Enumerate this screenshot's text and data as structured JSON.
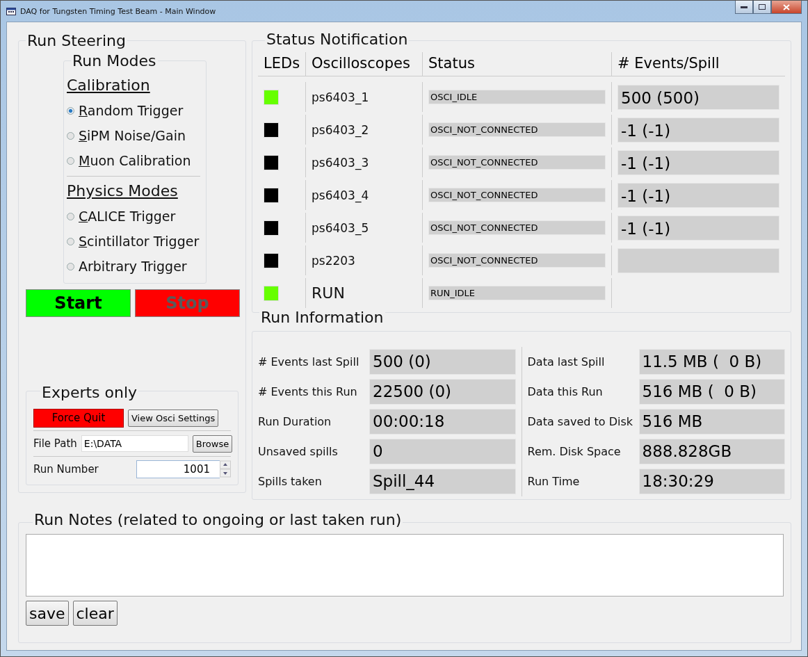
{
  "window": {
    "title": "DAQ for Tungsten Timing Test Beam - Main Window"
  },
  "run_steering": {
    "title": "Run Steering",
    "run_modes": {
      "title": "Run Modes",
      "groups": [
        {
          "heading": "Calibration",
          "options": [
            {
              "label": "Random Trigger",
              "selected": true,
              "mnemonic": true
            },
            {
              "label": "SiPM Noise/Gain",
              "selected": false,
              "mnemonic": true
            },
            {
              "label": "Muon Calibration",
              "selected": false,
              "mnemonic": true
            }
          ]
        },
        {
          "heading": "Physics Modes",
          "options": [
            {
              "label": "CALICE Trigger",
              "selected": false,
              "mnemonic": true
            },
            {
              "label": "Scintillator Trigger",
              "selected": false,
              "mnemonic": true
            },
            {
              "label": "Arbitrary Trigger",
              "selected": false,
              "mnemonic": false
            }
          ]
        }
      ]
    },
    "start_button": {
      "label": "Start",
      "disabled": false
    },
    "stop_button": {
      "label": "Stop",
      "disabled": true
    }
  },
  "experts": {
    "title": "Experts only",
    "force_quit": "Force Quit",
    "view_osci_settings": "View Osci Settings",
    "file_path_label": "File Path",
    "file_path_value": "E:\\DATA",
    "browse": "Browse",
    "run_number_label": "Run Number",
    "run_number_value": "1001"
  },
  "status": {
    "title": "Status Notification",
    "columns": [
      "LEDs",
      "Oscilloscopes",
      "Status",
      "# Events/Spill"
    ],
    "rows": [
      {
        "kind": "osci",
        "color": "#66ff00",
        "name": "ps6403_1",
        "status": "OSCI_IDLE",
        "events": "500 (500)"
      },
      {
        "kind": "osci",
        "color": "#000000",
        "name": "ps6403_2",
        "status": "OSCI_NOT_CONNECTED",
        "events": "-1 (-1)"
      },
      {
        "kind": "osci",
        "color": "#000000",
        "name": "ps6403_3",
        "status": "OSCI_NOT_CONNECTED",
        "events": "-1 (-1)"
      },
      {
        "kind": "osci",
        "color": "#000000",
        "name": "ps6403_4",
        "status": "OSCI_NOT_CONNECTED",
        "events": "-1 (-1)"
      },
      {
        "kind": "osci",
        "color": "#000000",
        "name": "ps6403_5",
        "status": "OSCI_NOT_CONNECTED",
        "events": "-1 (-1)"
      },
      {
        "kind": "osci",
        "color": "#000000",
        "name": "ps2203",
        "status": "OSCI_NOT_CONNECTED"
      },
      {
        "kind": "run",
        "color": "#66ff00",
        "name": "RUN",
        "status": "RUN_IDLE"
      }
    ]
  },
  "run_info": {
    "title": "Run Information",
    "left": [
      {
        "label": "# Events last Spill",
        "value": "500 (0)"
      },
      {
        "label": "# Events this Run",
        "value": "22500 (0)"
      },
      {
        "label": "Run Duration",
        "value": "00:00:18"
      },
      {
        "label": "Unsaved spills",
        "value": "0"
      },
      {
        "label": "Spills taken",
        "value": "Spill_44"
      }
    ],
    "right": [
      {
        "label": "Data last Spill",
        "value": "11.5 MB (  0 B)"
      },
      {
        "label": "Data this Run",
        "value": "516 MB (  0 B)"
      },
      {
        "label": "Data saved to Disk",
        "value": "516 MB"
      },
      {
        "label": "Rem. Disk Space",
        "value": "888.828GB"
      },
      {
        "label": "Run Time",
        "value": "18:30:29"
      }
    ]
  },
  "notes": {
    "title": "Run Notes (related to ongoing or last taken run)",
    "buttons": [
      "save",
      "clear"
    ]
  }
}
